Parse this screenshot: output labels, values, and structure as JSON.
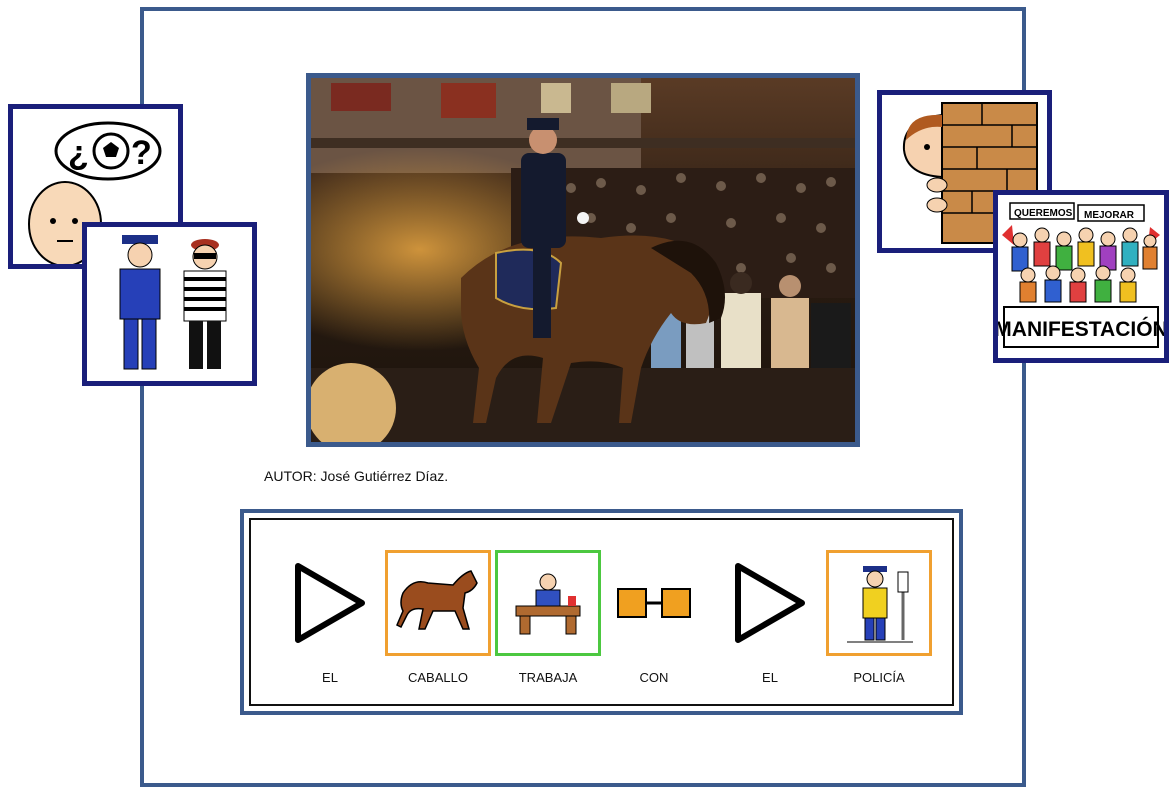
{
  "author": "AUTOR: José Gutiérrez Díaz.",
  "sentence": [
    {
      "label": "EL",
      "icon": "article-arrow-icon",
      "frame": "none"
    },
    {
      "label": "CABALLO",
      "icon": "horse-icon",
      "frame": "orange"
    },
    {
      "label": "TRABAJA",
      "icon": "working-at-desk-icon",
      "frame": "green"
    },
    {
      "label": "CON",
      "icon": "with-link-icon",
      "frame": "none"
    },
    {
      "label": "EL",
      "icon": "article-arrow-icon",
      "frame": "none"
    },
    {
      "label": "POLICÍA",
      "icon": "police-officer-icon",
      "frame": "orange"
    }
  ],
  "cards": {
    "manifestacion_banner_left": "QUEREMOS",
    "manifestacion_banner_right": "MEJORAR",
    "manifestacion_caption": "MANIFESTACIÓN",
    "thought_text_left": "¿",
    "thought_text_right": "?"
  },
  "colors": {
    "frame_blue": "#3b5a8c",
    "card_border": "#1a1f7a",
    "orange_frame": "#f0a030",
    "green_frame": "#4cc840"
  }
}
